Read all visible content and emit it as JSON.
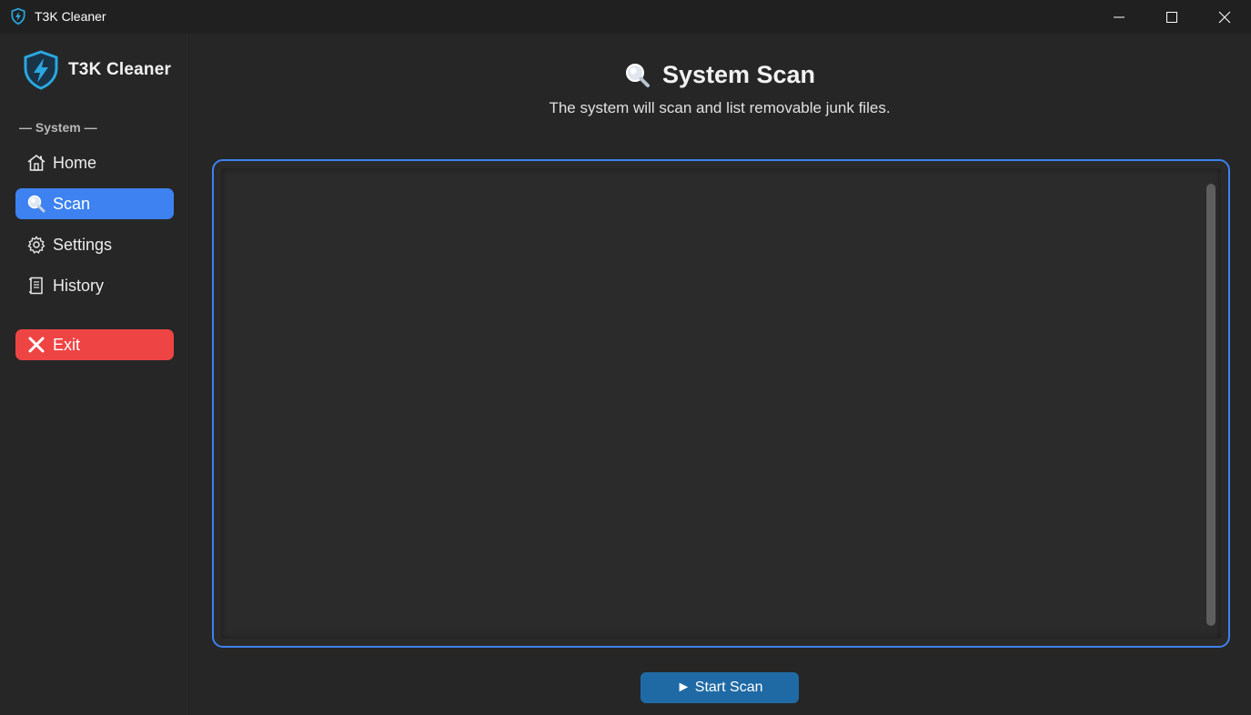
{
  "window": {
    "title": "T3K Cleaner",
    "controls": [
      "minimize-icon",
      "maximize-icon",
      "close-icon"
    ]
  },
  "sidebar": {
    "brand_name": "T3K Cleaner",
    "section_label": "— System —",
    "items": [
      {
        "label": "Home",
        "icon": "home-icon",
        "active": false
      },
      {
        "label": "Scan",
        "icon": "magnifier-icon",
        "active": true
      },
      {
        "label": "Settings",
        "icon": "gear-icon",
        "active": false
      },
      {
        "label": "History",
        "icon": "scroll-icon",
        "active": false
      }
    ],
    "exit_label": "Exit"
  },
  "main": {
    "title": "System Scan",
    "subtitle": "The system will scan and list removable junk files.",
    "start_button_label": "► Start Scan"
  },
  "colors": {
    "accent": "#3d82f0",
    "exit": "#ef4444",
    "start_button": "#1f6aa5",
    "background": "#262626"
  }
}
